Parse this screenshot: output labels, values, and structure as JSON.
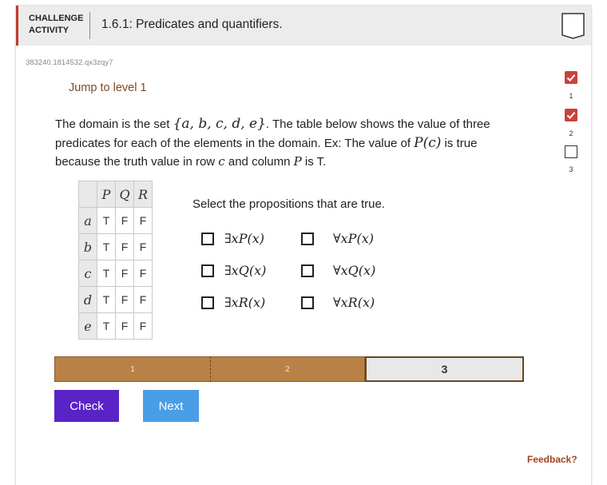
{
  "header": {
    "badge_line1": "CHALLENGE",
    "badge_line2": "ACTIVITY",
    "title": "1.6.1: Predicates and quantifiers."
  },
  "activity_code": "383240.1814532.qx3zqy7",
  "jump_link": "Jump to level 1",
  "prompt": {
    "part1": "The domain is the set ",
    "set": "{a, b, c, d, e}",
    "part2": ". The table below shows the value of three predicates for each of the elements in the domain. Ex: The value of ",
    "example_expr": "P(c)",
    "part3": " is true because the truth value in row ",
    "row_var": "c",
    "part4": " and column ",
    "col_var": "P",
    "part5": " is T."
  },
  "truth_table": {
    "columns": [
      "P",
      "Q",
      "R"
    ],
    "rows": [
      {
        "label": "a",
        "values": [
          "T",
          "F",
          "F"
        ]
      },
      {
        "label": "b",
        "values": [
          "T",
          "F",
          "F"
        ]
      },
      {
        "label": "c",
        "values": [
          "T",
          "F",
          "F"
        ]
      },
      {
        "label": "d",
        "values": [
          "T",
          "F",
          "F"
        ]
      },
      {
        "label": "e",
        "values": [
          "T",
          "F",
          "F"
        ]
      }
    ]
  },
  "question": "Select the propositions that are true.",
  "options": [
    {
      "label": "∃xP(x)",
      "checked": false
    },
    {
      "label": "∀xP(x)",
      "checked": false
    },
    {
      "label": "∃xQ(x)",
      "checked": false
    },
    {
      "label": "∀xQ(x)",
      "checked": false
    },
    {
      "label": "∃xR(x)",
      "checked": false
    },
    {
      "label": "∀xR(x)",
      "checked": false
    }
  ],
  "progress": {
    "segments": [
      {
        "label": "1",
        "state": "done"
      },
      {
        "label": "2",
        "state": "done"
      },
      {
        "label": "3",
        "state": "current"
      }
    ]
  },
  "buttons": {
    "check": "Check",
    "next": "Next"
  },
  "feedback": "Feedback?",
  "levels": [
    {
      "label": "1",
      "state": "done"
    },
    {
      "label": "2",
      "state": "done"
    },
    {
      "label": "3",
      "state": "todo"
    }
  ],
  "colors": {
    "accent_red": "#c0392b",
    "progress_brown": "#b98145",
    "check_purple": "#5a23c8",
    "next_blue": "#4a9ee8",
    "level_done_red": "#c9423a"
  }
}
